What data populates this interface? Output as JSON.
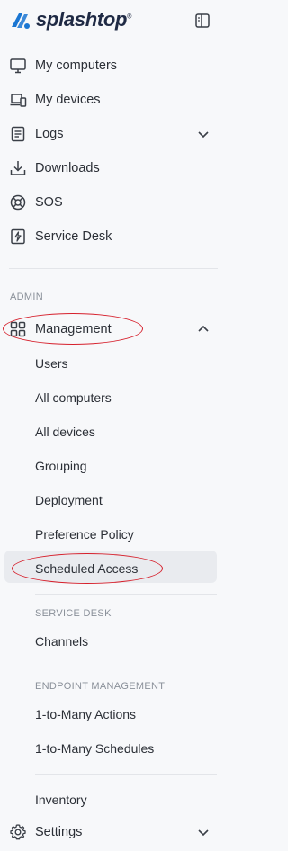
{
  "brand": {
    "name": "splashtop"
  },
  "nav": [
    {
      "key": "my_computers",
      "label": "My computers",
      "icon": "monitor-icon"
    },
    {
      "key": "my_devices",
      "label": "My devices",
      "icon": "devices-icon"
    },
    {
      "key": "logs",
      "label": "Logs",
      "icon": "logs-icon",
      "expandable": true,
      "expanded": false
    },
    {
      "key": "downloads",
      "label": "Downloads",
      "icon": "download-icon"
    },
    {
      "key": "sos",
      "label": "SOS",
      "icon": "sos-icon"
    },
    {
      "key": "service_desk",
      "label": "Service Desk",
      "icon": "service-desk-icon"
    }
  ],
  "admin": {
    "section_label": "ADMIN",
    "management": {
      "label": "Management",
      "icon": "grid-icon",
      "expanded": true,
      "items": [
        {
          "label": "Users"
        },
        {
          "label": "All computers"
        },
        {
          "label": "All devices"
        },
        {
          "label": "Grouping"
        },
        {
          "label": "Deployment"
        },
        {
          "label": "Preference Policy"
        },
        {
          "label": "Scheduled Access",
          "selected": true
        }
      ],
      "service_desk": {
        "section_label": "SERVICE DESK",
        "items": [
          {
            "label": "Channels"
          }
        ]
      },
      "endpoint_management": {
        "section_label": "ENDPOINT MANAGEMENT",
        "items": [
          {
            "label": "1-to-Many Actions"
          },
          {
            "label": "1-to-Many Schedules"
          }
        ]
      },
      "extra_items": [
        {
          "label": "Inventory"
        }
      ]
    },
    "settings": {
      "label": "Settings",
      "icon": "gear-icon",
      "expandable": true,
      "expanded": false
    }
  },
  "colors": {
    "background": "#f7f8fa",
    "text": "#2b2f36",
    "muted": "#8a9099",
    "selected_bg": "#e9ebef",
    "brand": "#1a76d2",
    "annotation": "#d6202c"
  }
}
